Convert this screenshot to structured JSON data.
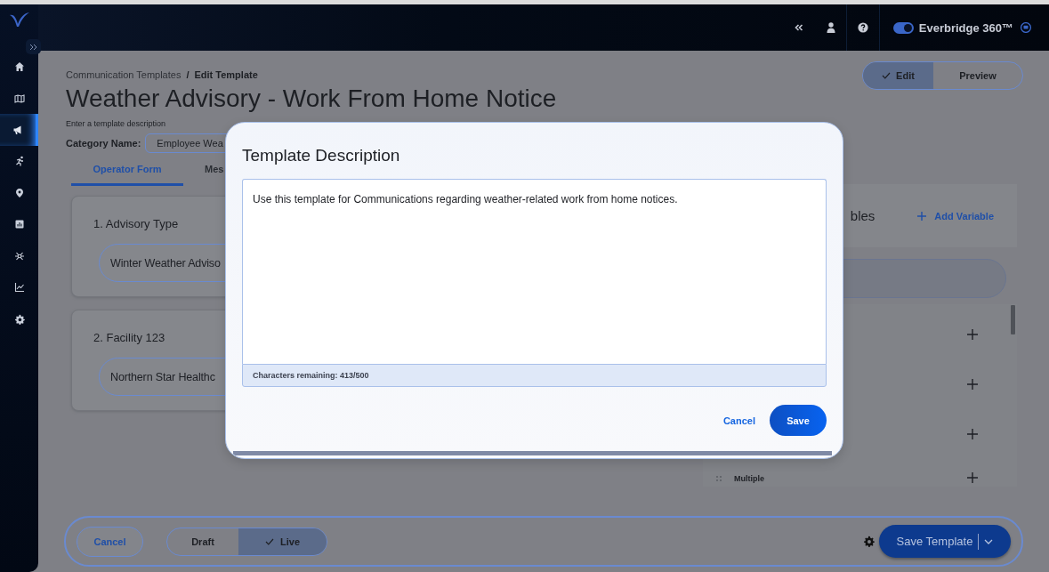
{
  "sidebar": {
    "items": [
      {
        "kind": "home",
        "selected": false
      },
      {
        "kind": "map",
        "selected": false
      },
      {
        "kind": "megaphone",
        "selected": true
      },
      {
        "kind": "runner",
        "selected": false
      },
      {
        "kind": "pin",
        "selected": false
      },
      {
        "kind": "bar-chart",
        "selected": false
      },
      {
        "kind": "network",
        "selected": false
      },
      {
        "kind": "line-chart",
        "selected": false
      },
      {
        "kind": "gear",
        "selected": false
      }
    ]
  },
  "top_bar": {
    "toggle": {
      "on": true
    },
    "product": "Everbridge 360™"
  },
  "breadcrumb": {
    "items": [
      "Communication Templates",
      "Edit Template"
    ],
    "separator": "/"
  },
  "mode_switch": [
    {
      "label": "Edit",
      "selected": true
    },
    {
      "label": "Preview",
      "selected": false
    }
  ],
  "title": "Weather Advisory - Work From Home Notice",
  "description_prompt": "Enter a template description",
  "category": {
    "label": "Category Name:",
    "value": "Employee Wea"
  },
  "tabs": [
    {
      "label": "Operator Form",
      "selected": true
    },
    {
      "label": "Mes",
      "selected": false
    }
  ],
  "form_fields": [
    {
      "label": "1. Advisory Type",
      "value": "Winter Weather Adviso"
    },
    {
      "label": "2. Facility 123",
      "value": "Northern Star Healthc"
    }
  ],
  "variables_panel": {
    "title": "bles",
    "add_label": "Add Variable",
    "rows": [
      {
        "kind": "hidden"
      },
      {
        "kind": "hidden"
      },
      {
        "kind": "hidden"
      },
      {
        "kind": "labeled",
        "label": "Multiple"
      }
    ]
  },
  "bottom_bar": {
    "cancel": "Cancel",
    "status": [
      {
        "label": "Draft",
        "selected": false
      },
      {
        "label": "Live",
        "selected": true
      }
    ],
    "save": "Save Template"
  },
  "dialog": {
    "title": "Template Description",
    "value": "Use this template for Communications regarding weather-related work from home notices.",
    "counter": "Characters remaining: 413/500",
    "buttons": [
      {
        "label": "Cancel",
        "kind": "text"
      },
      {
        "label": "Save",
        "kind": "primary"
      }
    ]
  }
}
